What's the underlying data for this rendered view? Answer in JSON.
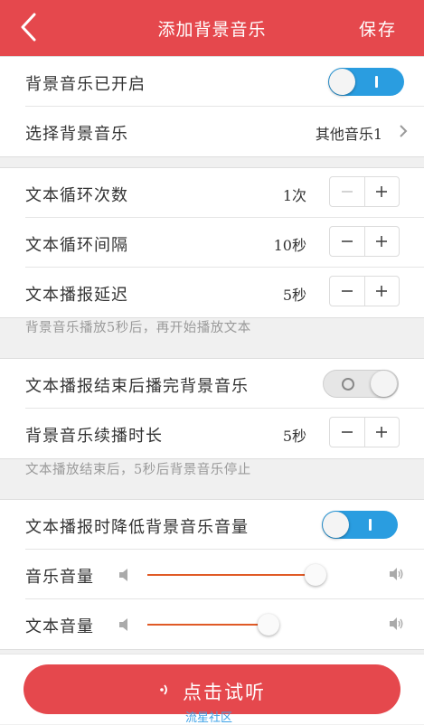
{
  "header": {
    "title": "添加背景音乐",
    "save_label": "保存"
  },
  "settings": {
    "bg_music": {
      "label": "背景音乐已开启",
      "enabled": true
    },
    "select_music": {
      "label": "选择背景音乐",
      "value": "其他音乐1"
    },
    "loop_count": {
      "label": "文本循环次数",
      "value": "1次"
    },
    "loop_interval": {
      "label": "文本循环间隔",
      "value": "10秒"
    },
    "play_delay": {
      "label": "文本播报延迟",
      "value": "5秒"
    },
    "delay_note": "背景音乐播放5秒后，再开始播放文本",
    "finish_music": {
      "label": "文本播报结束后播完背景音乐",
      "enabled": false
    },
    "continue_duration": {
      "label": "背景音乐续播时长",
      "value": "5秒"
    },
    "continue_note": "文本播放结束后，5秒后背景音乐停止",
    "lower_volume": {
      "label": "文本播报时降低背景音乐音量",
      "enabled": true
    },
    "music_volume": {
      "label": "音乐音量",
      "level": 0.93
    },
    "text_volume": {
      "label": "文本音量",
      "level": 0.67
    }
  },
  "footer": {
    "listen_label": "点击试听"
  },
  "watermark": "流星社区",
  "colors": {
    "brand_red": "#e5484d",
    "toggle_on": "#2a9de0",
    "slider": "#e05a26"
  }
}
